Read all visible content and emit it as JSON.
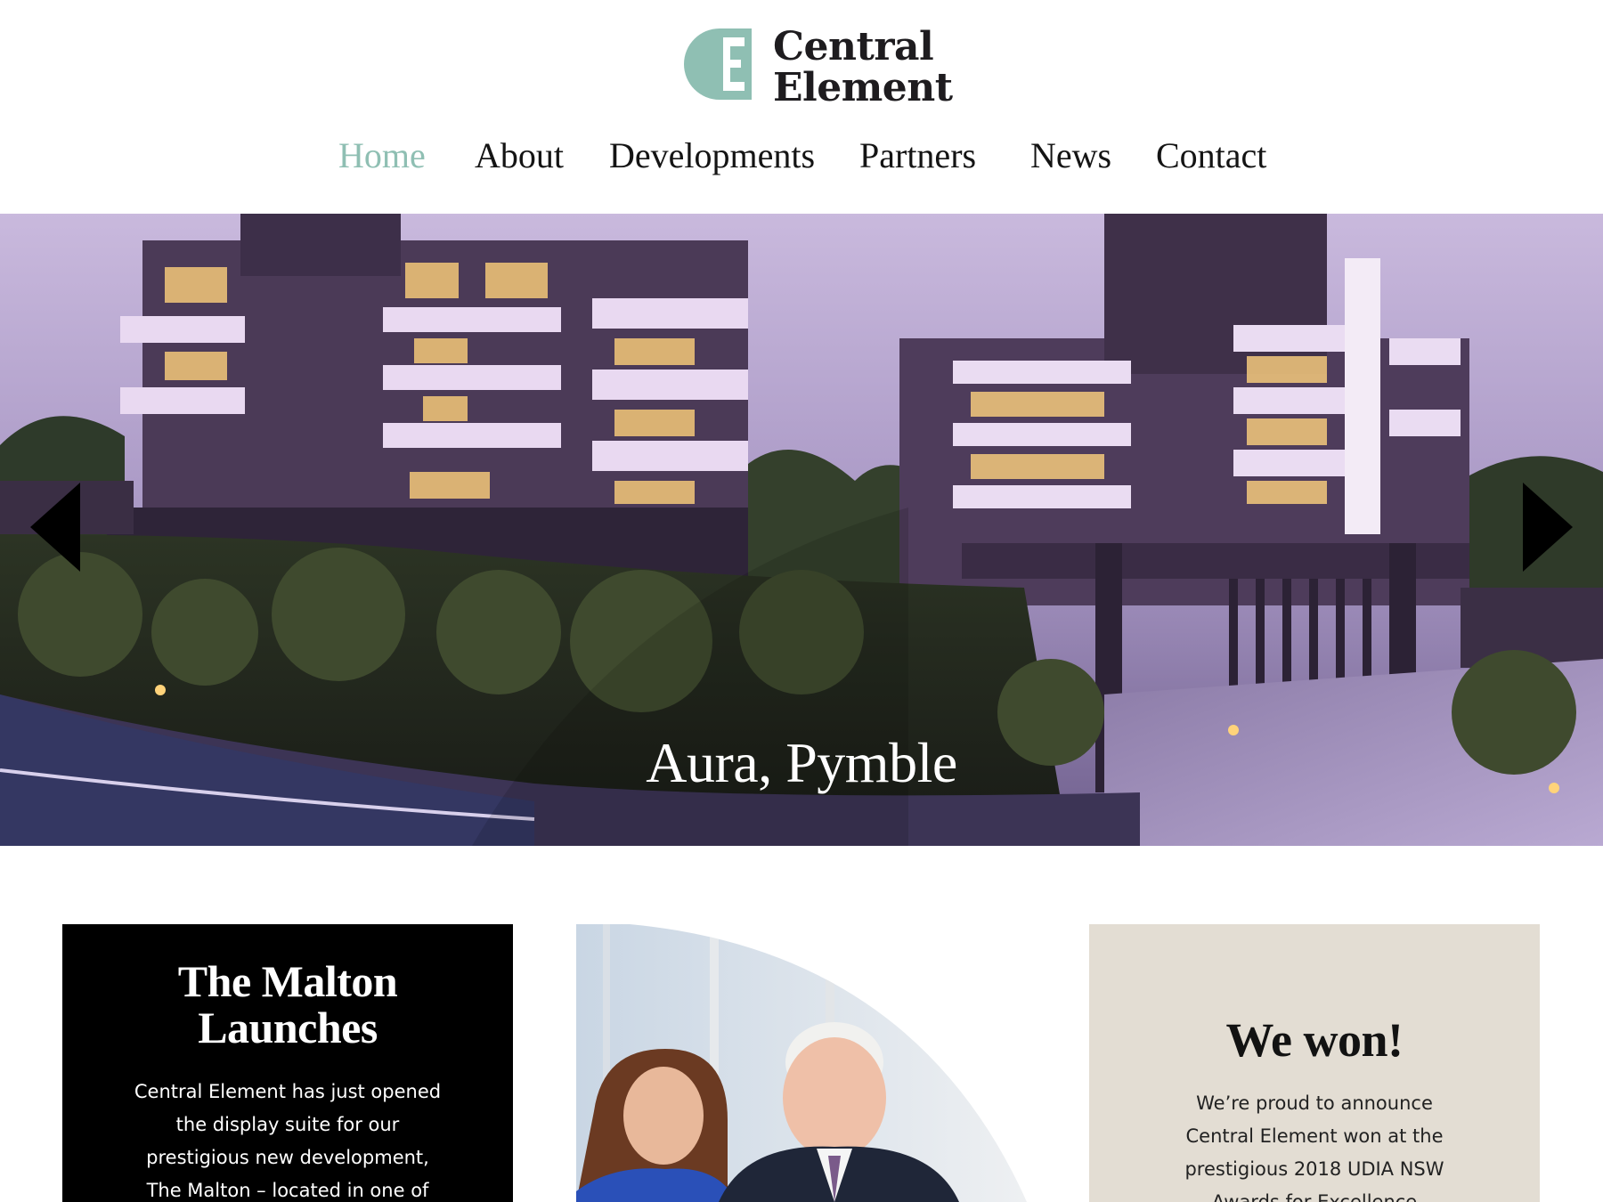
{
  "brand": {
    "name_line1": "Central",
    "name_line2": "Element",
    "accent_color": "#8fbfb3"
  },
  "nav": {
    "items": [
      {
        "label": "Home",
        "active": true
      },
      {
        "label": "About",
        "active": false
      },
      {
        "label": "Developments",
        "active": false
      },
      {
        "label": "Partners",
        "active": false
      },
      {
        "label": "News",
        "active": false
      },
      {
        "label": "Contact",
        "active": false
      }
    ]
  },
  "hero": {
    "caption": "Aura, Pymble",
    "prev_icon": "triangle-left-icon",
    "next_icon": "triangle-right-icon"
  },
  "cards": {
    "malton": {
      "title_line1": "The Malton",
      "title_line2": "Launches",
      "text_lines": [
        "Central Element has just opened",
        "the display suite for our",
        "prestigious new development,",
        "The Malton – located in one of"
      ]
    },
    "award": {
      "title": "We won!",
      "text_lines": [
        "We’re proud to announce",
        "Central Element won at the",
        "prestigious 2018 UDIA NSW",
        "Awards for Excellence"
      ],
      "background": "#e3ddd3"
    }
  }
}
